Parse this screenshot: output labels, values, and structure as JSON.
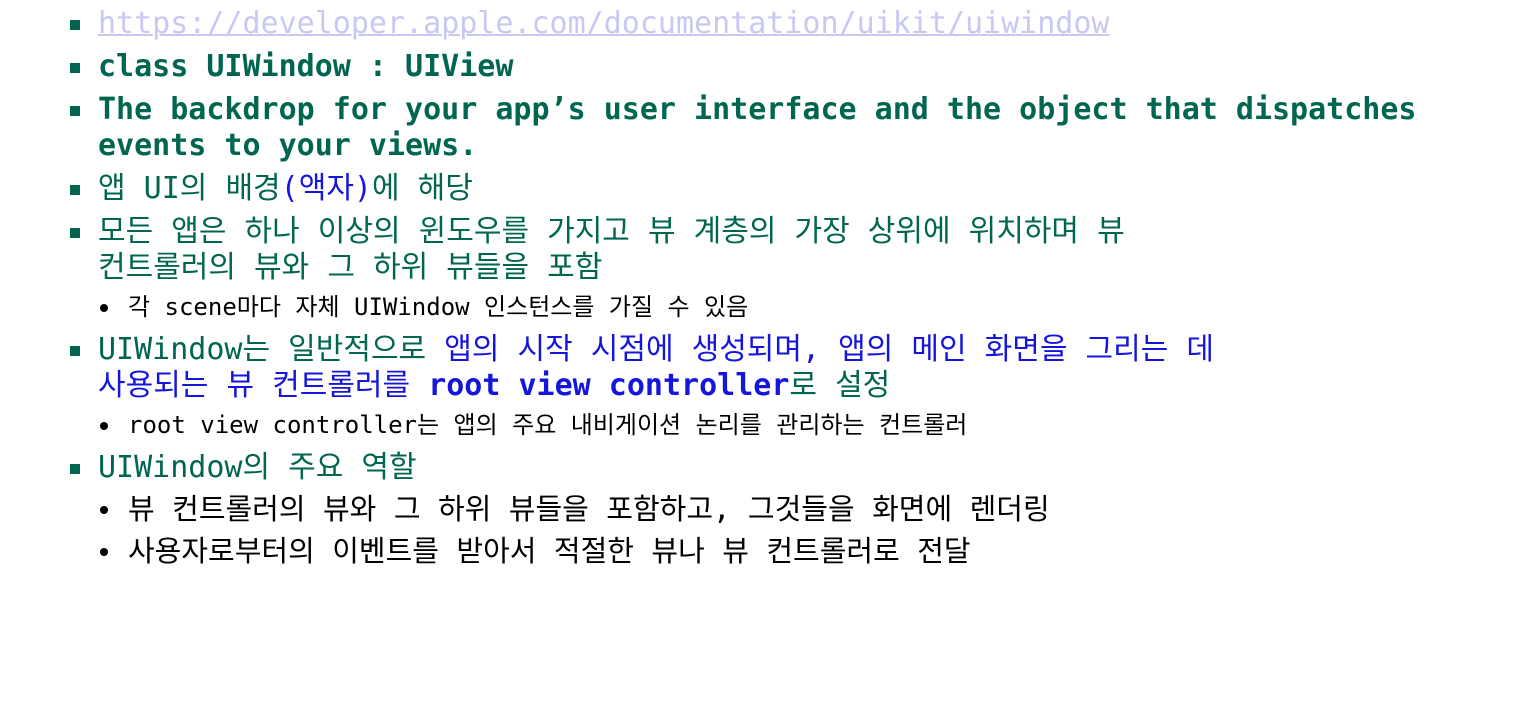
{
  "bullets": [
    {
      "link": "https://developer.apple.com/documentation/uikit/uiwindow"
    },
    {
      "text": "class UIWindow : UIView"
    },
    {
      "line1": "The backdrop for your app’s user interface and the object that dispatches",
      "line2": "events to your views."
    },
    {
      "a": "앱 UI의 배경",
      "b": "(액자)",
      "c": "에 해당"
    },
    {
      "line1": "모든 앱은 하나 이상의 윈도우를 가지고 뷰 계층의 가장 상위에 위치하며 뷰",
      "line2": "컨트롤러의 뷰와 그 하위 뷰들을 포함",
      "sub": "각 scene마다 자체 UIWindow 인스턴스를 가질 수 있음"
    },
    {
      "a": "UIWindow는 일반적으로 ",
      "b": "앱의 시작 시점에 생성되며, 앱의 메인 화면을 그리는 데",
      "c": "사용되는 뷰 컨트롤러를 ",
      "d": "root view controller",
      "e": "로 설정",
      "sub": "root view controller는 앱의 주요 내비게이션 논리를 관리하는 컨트롤러"
    },
    {
      "text": "UIWindow의 주요 역할",
      "subs": [
        "뷰 컨트롤러의 뷰와 그 하위 뷰들을 포함하고, 그것들을 화면에 렌더링",
        "사용자로부터의 이벤트를 받아서 적절한 뷰나 뷰 컨트롤러로 전달"
      ]
    }
  ],
  "colors": {
    "text": "#006650",
    "accent": "#1515dd",
    "link": "#c8c8f2"
  }
}
